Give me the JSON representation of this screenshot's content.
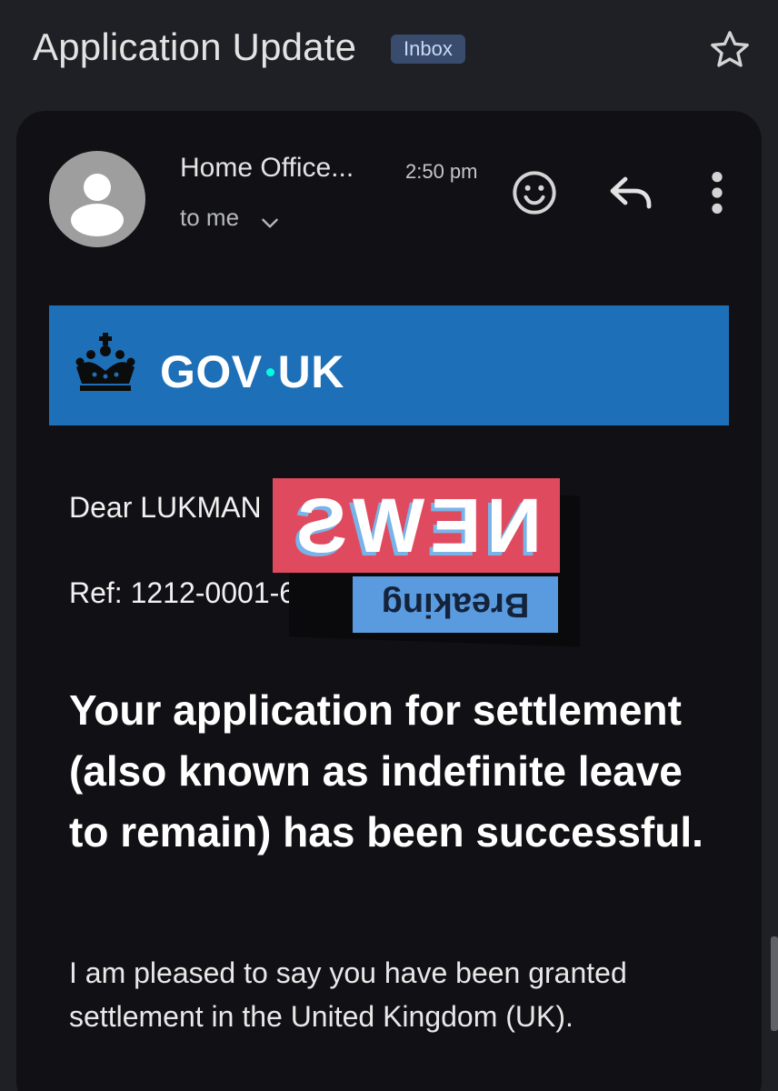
{
  "header": {
    "subject": "Application Update",
    "label_badge": "Inbox",
    "star_icon": "star-outline-icon"
  },
  "message": {
    "sender": "Home Office...",
    "time": "2:50 pm",
    "recipient": "to me",
    "icons": [
      "avatar-icon",
      "chevron-down-icon",
      "emoji-icon",
      "reply-icon",
      "more-vert-icon"
    ]
  },
  "banner": {
    "logo_left": "GOV",
    "logo_right": "UK",
    "crown_icon": "crown-icon",
    "color": "#1d70b8"
  },
  "body": {
    "salutation": "Dear LUKMAN",
    "ref": "Ref: 1212-0001-600",
    "headline": "Your application for settlement (also known as indefinite leave to remain) has been successful.",
    "paragraph": "I am pleased to say you have been granted settlement in the United Kingdom (UK)."
  },
  "overlay": {
    "news": "NEWS",
    "breaking": "Breaking"
  }
}
